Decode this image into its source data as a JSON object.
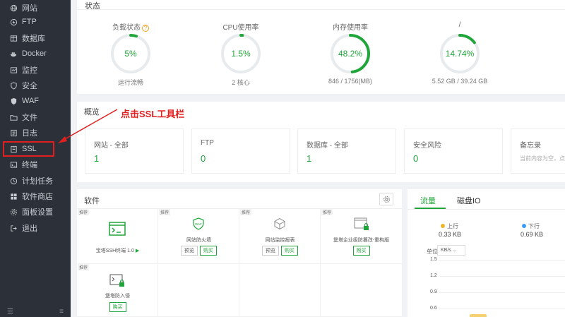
{
  "sidebar": {
    "items": [
      {
        "label": "网站",
        "icon": "globe-icon"
      },
      {
        "label": "FTP",
        "icon": "ftp-icon"
      },
      {
        "label": "数据库",
        "icon": "database-icon"
      },
      {
        "label": "Docker",
        "icon": "docker-icon"
      },
      {
        "label": "监控",
        "icon": "monitor-icon"
      },
      {
        "label": "安全",
        "icon": "shield-icon"
      },
      {
        "label": "WAF",
        "icon": "waf-icon"
      },
      {
        "label": "文件",
        "icon": "folder-icon"
      },
      {
        "label": "日志",
        "icon": "log-icon"
      },
      {
        "label": "SSL",
        "icon": "ssl-icon"
      },
      {
        "label": "终端",
        "icon": "terminal-icon"
      },
      {
        "label": "计划任务",
        "icon": "clock-icon"
      },
      {
        "label": "软件商店",
        "icon": "store-icon"
      },
      {
        "label": "面板设置",
        "icon": "gear-icon"
      },
      {
        "label": "退出",
        "icon": "logout-icon"
      }
    ],
    "bottom_left": "☰",
    "bottom_right": "≡"
  },
  "status": {
    "title": "状态",
    "gauges": [
      {
        "name": "负载状态",
        "value": "5%",
        "percent": 5,
        "sub": "运行流畅",
        "help": "?"
      },
      {
        "name": "CPU使用率",
        "value": "1.5%",
        "percent": 1.5,
        "sub": "2 核心"
      },
      {
        "name": "内存使用率",
        "value": "48.2%",
        "percent": 48.2,
        "sub": "846 / 1756(MB)"
      },
      {
        "name": "/",
        "value": "14.74%",
        "percent": 14.74,
        "sub": "5.52 GB / 39.24 GB"
      }
    ]
  },
  "annotation": "点击SSL工具栏",
  "overview": {
    "title": "概览",
    "cards": [
      {
        "label": "网站 - 全部",
        "value": "1"
      },
      {
        "label": "FTP",
        "value": "0"
      },
      {
        "label": "数据库 - 全部",
        "value": "1"
      },
      {
        "label": "安全风险",
        "value": "0"
      },
      {
        "label": "备忘录",
        "value": "",
        "note": "当前内容为空，点击"
      }
    ]
  },
  "software": {
    "title": "软件",
    "items": [
      {
        "name": "宝塔SSH终端 1.0",
        "tag": "",
        "buttons": [],
        "play": "▶"
      },
      {
        "name": "网站防火墙",
        "tag": "推荐",
        "buttons": [
          "预览",
          "购买"
        ]
      },
      {
        "name": "网站监控报表",
        "tag": "推荐",
        "buttons": [
          "预览",
          "购买"
        ]
      },
      {
        "name": "堡塔企业级防篡改-重构版",
        "tag": "推荐",
        "buttons": [
          "购买"
        ]
      },
      {
        "name": "堡塔防入侵",
        "tag": "推荐",
        "buttons": [
          "购买"
        ]
      }
    ],
    "first_tag": "推荐"
  },
  "traffic": {
    "tabs": [
      "流量",
      "磁盘IO"
    ],
    "up_label": "上行",
    "up_value": "0.33 KB",
    "down_label": "下行",
    "down_value": "0.69 KB",
    "unit_label": "单位",
    "unit_value": "KB/s",
    "y_ticks": [
      "1.5",
      "1.2",
      "0.9",
      "0.6"
    ],
    "colors": {
      "up": "#f0b429",
      "down": "#3b9eff",
      "accent": "#20a53a"
    }
  }
}
